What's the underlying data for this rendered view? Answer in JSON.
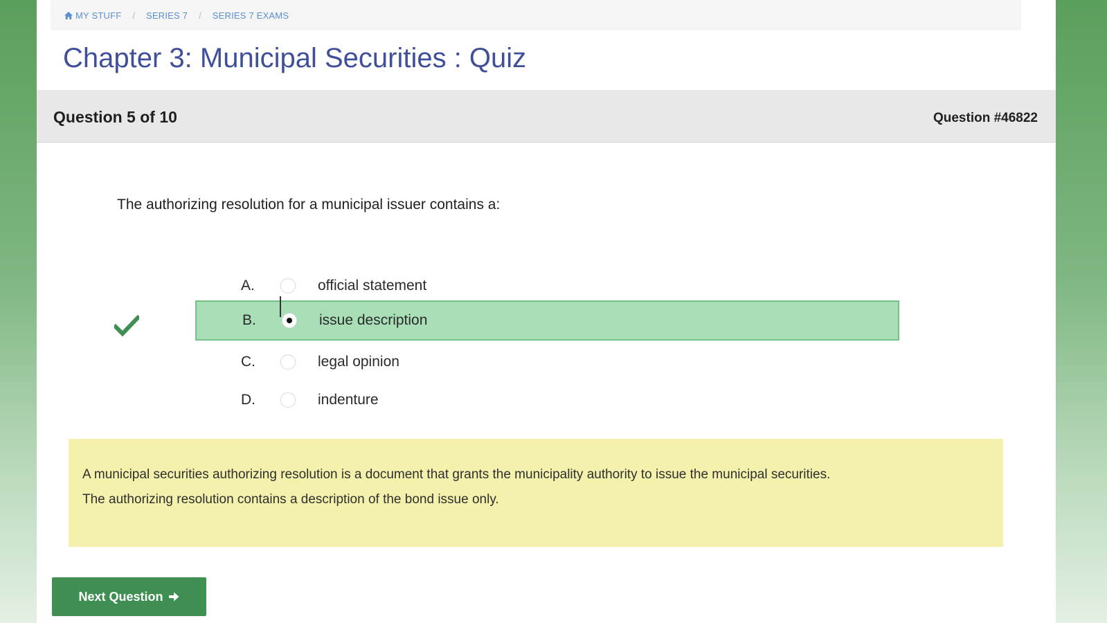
{
  "breadcrumb": {
    "items": [
      "MY STUFF",
      "SERIES 7",
      "SERIES 7 EXAMS"
    ],
    "separator": "/",
    "home_icon": "home-icon"
  },
  "page": {
    "title": "Chapter 3: Municipal Securities : Quiz"
  },
  "question_bar": {
    "progress": "Question 5 of 10",
    "question_id": "Question #46822"
  },
  "question": {
    "text": "The authorizing resolution for a municipal issuer contains a:"
  },
  "options": [
    {
      "letter": "A.",
      "text": "official statement",
      "selected": false
    },
    {
      "letter": "B.",
      "text": "issue description",
      "selected": true
    },
    {
      "letter": "C.",
      "text": "legal opinion",
      "selected": false
    },
    {
      "letter": "D.",
      "text": "indenture",
      "selected": false
    }
  ],
  "result": {
    "icon": "checkmark-icon",
    "correct": true,
    "correct_color": "#3f8f53"
  },
  "explanation": {
    "line1": "A municipal securities authorizing resolution is a document that grants the municipality authority to issue the municipal securities.",
    "line2": "The authorizing resolution contains a description of the bond issue only."
  },
  "next_button": {
    "label": "Next Question",
    "icon": "arrow-right-icon"
  },
  "colors": {
    "title": "#3f4f9a",
    "selected_option": "#a8dfb6",
    "explanation_bg": "#f3f1ab",
    "button_bg": "#3f8f53",
    "breadcrumb_link": "#5b8fd2"
  }
}
